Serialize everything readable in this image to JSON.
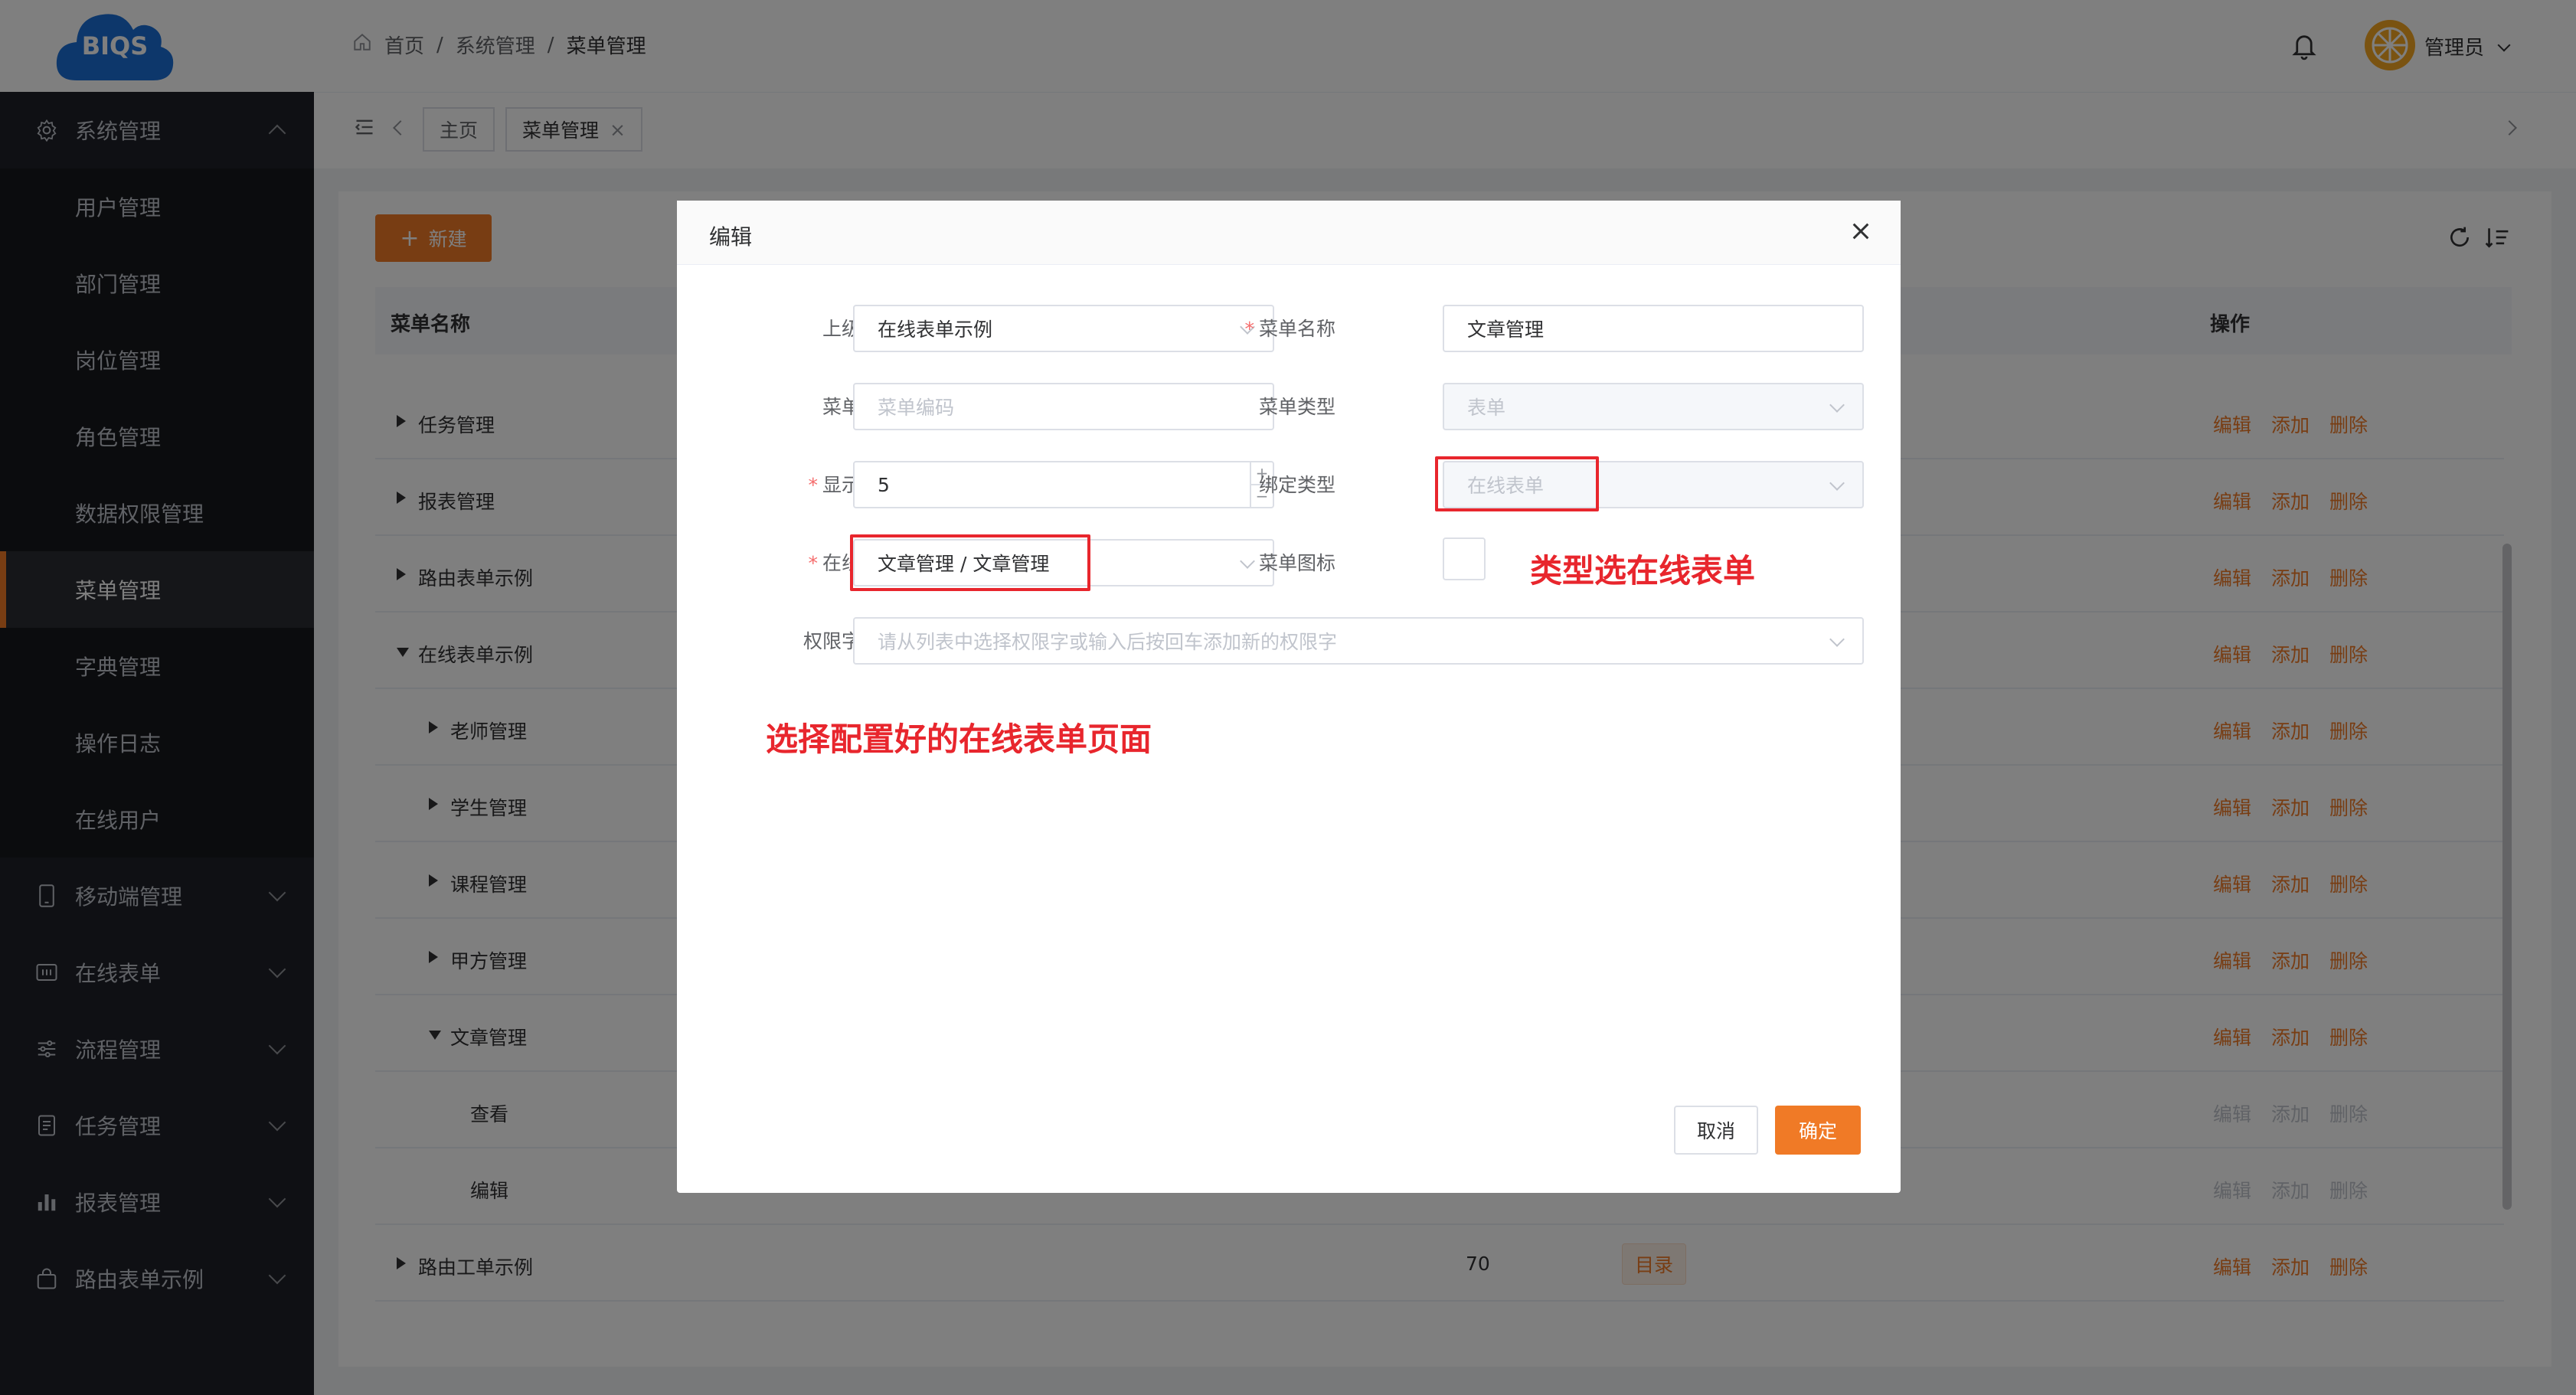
{
  "logo": {
    "text": "BIQS"
  },
  "sidebar": {
    "items": [
      {
        "label": "系统管理",
        "type": "top",
        "icon": "gear-icon",
        "expanded": true
      },
      {
        "label": "用户管理",
        "type": "sub"
      },
      {
        "label": "部门管理",
        "type": "sub"
      },
      {
        "label": "岗位管理",
        "type": "sub"
      },
      {
        "label": "角色管理",
        "type": "sub"
      },
      {
        "label": "数据权限管理",
        "type": "sub"
      },
      {
        "label": "菜单管理",
        "type": "sub",
        "active": true
      },
      {
        "label": "字典管理",
        "type": "sub"
      },
      {
        "label": "操作日志",
        "type": "sub"
      },
      {
        "label": "在线用户",
        "type": "sub"
      },
      {
        "label": "移动端管理",
        "type": "top",
        "icon": "mobile-icon"
      },
      {
        "label": "在线表单",
        "type": "top",
        "icon": "form-icon"
      },
      {
        "label": "流程管理",
        "type": "top",
        "icon": "sliders-icon"
      },
      {
        "label": "任务管理",
        "type": "top",
        "icon": "document-icon"
      },
      {
        "label": "报表管理",
        "type": "top",
        "icon": "bar-chart-icon"
      },
      {
        "label": "路由表单示例",
        "type": "top",
        "icon": "bag-icon"
      }
    ]
  },
  "header": {
    "breadcrumb": [
      "首页",
      "系统管理",
      "菜单管理"
    ],
    "user": "管理员"
  },
  "tags": [
    {
      "label": "主页"
    },
    {
      "label": "菜单管理",
      "closable": true
    }
  ],
  "toolbar": {
    "new_label": "新建"
  },
  "table": {
    "col_name": "菜单名称",
    "col_ops": "操作",
    "ops": [
      "编辑",
      "添加",
      "删除"
    ],
    "rows": [
      {
        "name": "任务管理",
        "level": 0,
        "arrow": "right"
      },
      {
        "name": "报表管理",
        "level": 0,
        "arrow": "right"
      },
      {
        "name": "路由表单示例",
        "level": 0,
        "arrow": "right"
      },
      {
        "name": "在线表单示例",
        "level": 0,
        "arrow": "down"
      },
      {
        "name": "老师管理",
        "level": 1,
        "arrow": "right"
      },
      {
        "name": "学生管理",
        "level": 1,
        "arrow": "right"
      },
      {
        "name": "课程管理",
        "level": 1,
        "arrow": "right"
      },
      {
        "name": "甲方管理",
        "level": 1,
        "arrow": "right"
      },
      {
        "name": "文章管理",
        "level": 1,
        "arrow": "down"
      },
      {
        "name": "查看",
        "level": 2,
        "arrow": "none",
        "dim": true
      },
      {
        "name": "编辑",
        "level": 2,
        "arrow": "none",
        "dim": true
      },
      {
        "name": "路由工单示例",
        "level": 0,
        "arrow": "right",
        "order": "70",
        "type_badge": "目录"
      }
    ]
  },
  "dialog": {
    "title": "编辑",
    "parent_menu_label": "上级菜单",
    "parent_menu_value": "在线表单示例",
    "menu_name_label": "菜单名称",
    "menu_name_value": "文章管理",
    "menu_code_label": "菜单编码",
    "menu_code_placeholder": "菜单编码",
    "menu_type_label": "菜单类型",
    "menu_type_value": "表单",
    "display_order_label": "显示顺序",
    "display_order_value": "5",
    "bind_type_label": "绑定类型",
    "bind_type_value": "在线表单",
    "online_form_label": "在线表单",
    "online_form_value": "文章管理 / 文章管理",
    "menu_icon_label": "菜单图标",
    "perm_label": "权限字列表",
    "perm_placeholder": "请从列表中选择权限字或输入后按回车添加新的权限字",
    "cancel_label": "取消",
    "ok_label": "确定",
    "stepper_plus": "+",
    "stepper_minus": "−"
  },
  "annotations": {
    "bind_note": "类型选在线表单",
    "form_note": "选择配置好的在线表单页面"
  },
  "colors": {
    "accent": "#f07a26",
    "sidebar_bg": "#1f2128",
    "annotation": "#e8262d"
  }
}
